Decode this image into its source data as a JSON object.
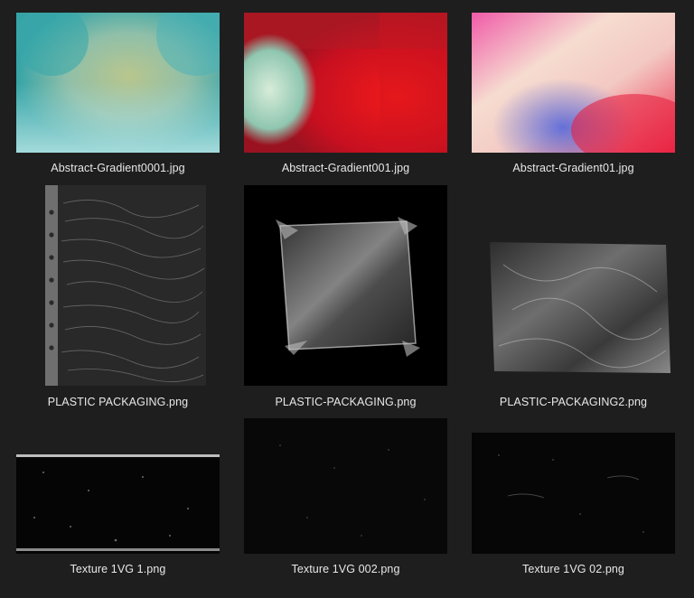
{
  "files": [
    {
      "name": "Abstract-Gradient0001.jpg"
    },
    {
      "name": "Abstract-Gradient001.jpg"
    },
    {
      "name": "Abstract-Gradient01.jpg"
    },
    {
      "name": "PLASTIC PACKAGING.png"
    },
    {
      "name": "PLASTIC-PACKAGING.png"
    },
    {
      "name": "PLASTIC-PACKAGING2.png"
    },
    {
      "name": "Texture 1VG 1.png"
    },
    {
      "name": "Texture 1VG 002.png"
    },
    {
      "name": "Texture 1VG 02.png"
    }
  ]
}
